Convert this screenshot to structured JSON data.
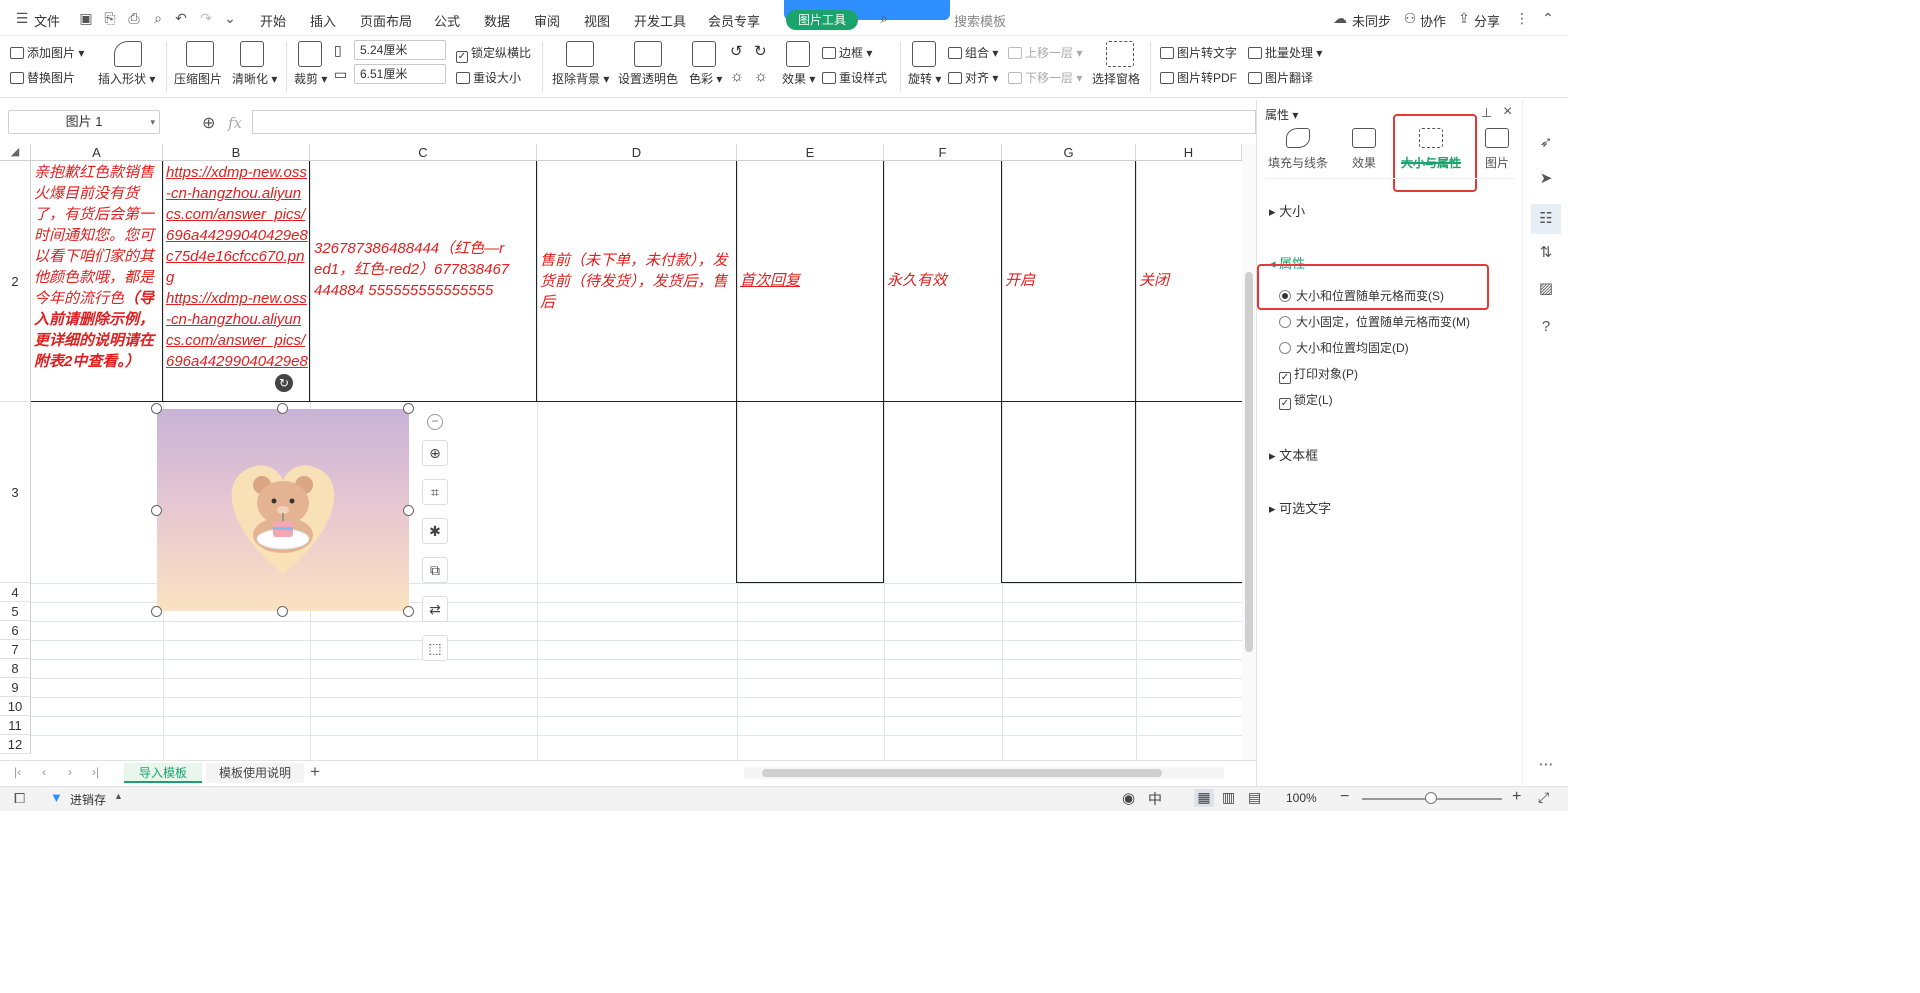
{
  "menubar": {
    "file_label": "文件",
    "tabs": [
      "开始",
      "插入",
      "页面布局",
      "公式",
      "数据",
      "审阅",
      "视图",
      "开发工具",
      "会员专享"
    ],
    "picture_tools_label": "图片工具",
    "search_placeholder": "搜索模板",
    "sync_label": "未同步",
    "collab_label": "协作",
    "share_label": "分享"
  },
  "ribbon": {
    "add_picture": "添加图片",
    "replace_picture": "替换图片",
    "insert_shape": "插入形状",
    "compress_picture": "压缩图片",
    "sharpen": "清晰化",
    "crop": "裁剪",
    "width_value": "5.24厘米",
    "height_value": "6.51厘米",
    "lock_aspect": "锁定纵横比",
    "reset_size": "重设大小",
    "remove_bg": "抠除背景",
    "set_transparent": "设置透明色",
    "color": "色彩",
    "effects": "效果",
    "border": "边框",
    "reset_style": "重设样式",
    "rotate": "旋转",
    "group": "组合",
    "align": "对齐",
    "bring_forward": "上移一层",
    "send_backward": "下移一层",
    "selection_pane": "选择窗格",
    "pic_to_text": "图片转文字",
    "pic_to_pdf": "图片转PDF",
    "batch": "批量处理",
    "pic_translate": "图片翻译"
  },
  "formula": {
    "namebox": "图片 1",
    "fx": "fx"
  },
  "columns": [
    "A",
    "B",
    "C",
    "D",
    "E",
    "F",
    "G",
    "H"
  ],
  "rows": [
    "2",
    "3",
    "4",
    "5",
    "6",
    "7",
    "8",
    "9",
    "10",
    "11",
    "12"
  ],
  "cells": {
    "a2_text": "亲抱歉红色款销售火爆目前没有货了，有货后会第一时间通知您。您可以看下咱们家的其他颜色款哦，都是今年的流行色",
    "a2_bold": "（导入前请删除示例，更详细的说明请在附表2中查看。）",
    "b2_link1": "https://xdmp-new.oss-cn-hangzhou.aliyuncs.com/answer_pics/696a44299040429e8c75d4e16cfcc670.png",
    "b2_link2": "https://xdmp-new.oss-cn-hangzhou.aliyuncs.com/answer_pics/696a44299040429e8",
    "c2": "326787386488444（红色—red1，红色-red2）677838467444884 555555555555555",
    "d2": "售前（未下单，未付款），发货前（待发货），发货后，售后",
    "e2": "首次回复",
    "f2": "永久有效",
    "g2": "开启",
    "h2": "关闭"
  },
  "sheets": {
    "active": "导入模板",
    "other": "模板使用说明"
  },
  "status": {
    "app_label": "进销存",
    "zoom": "100%"
  },
  "panel": {
    "title": "属性",
    "tabs": [
      "填充与线条",
      "效果",
      "大小与属性",
      "图片"
    ],
    "size_section": "大小",
    "props_section": "属性",
    "opt1": "大小和位置随单元格而变(S)",
    "opt2": "大小固定，位置随单元格而变(M)",
    "opt3": "大小和位置均固定(D)",
    "print_obj": "打印对象(P)",
    "locked": "锁定(L)",
    "textbox_section": "文本框",
    "alt_text_section": "可选文字"
  },
  "colors": {
    "accent_green": "#1aa36b",
    "red_text": "#e02020",
    "highlight_red": "#e53935"
  }
}
